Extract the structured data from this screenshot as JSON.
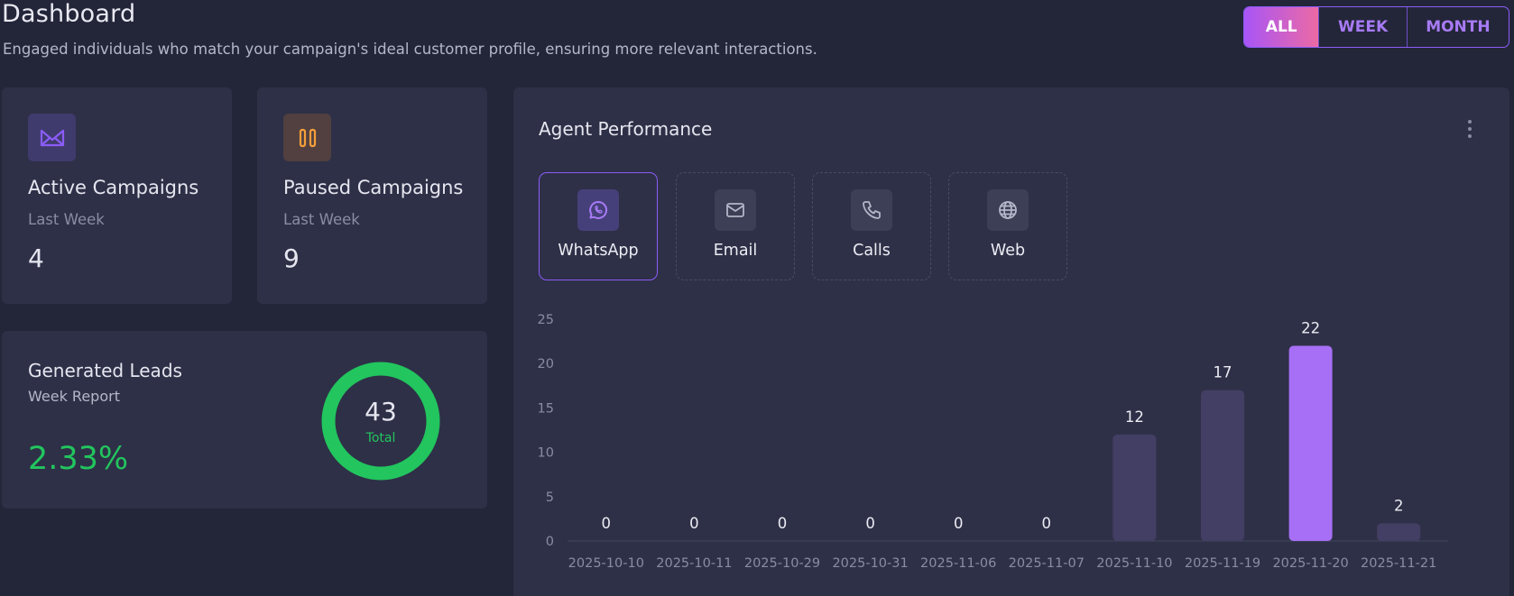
{
  "header": {
    "title": "Dashboard",
    "subtitle": "Engaged individuals who match your campaign's ideal customer profile, ensuring more relevant interactions."
  },
  "range_toggle": {
    "options": [
      "ALL",
      "WEEK",
      "MONTH"
    ],
    "selected": "ALL"
  },
  "cards": {
    "active": {
      "title": "Active Campaigns",
      "subtitle": "Last Week",
      "value": "4",
      "icon": "envelope-open-icon",
      "icon_color": "#8b5cf6"
    },
    "paused": {
      "title": "Paused Campaigns",
      "subtitle": "Last Week",
      "value": "9",
      "icon": "pause-icon",
      "icon_color": "#f59e3b"
    }
  },
  "leads": {
    "title": "Generated Leads",
    "subtitle": "Week Report",
    "percent": "2.33%",
    "total": "43",
    "total_label": "Total",
    "ring_color": "#22c55e"
  },
  "performance": {
    "title": "Agent Performance",
    "menu_icon": "more-vertical-icon",
    "channels": [
      {
        "label": "WhatsApp",
        "icon": "whatsapp-icon",
        "active": true
      },
      {
        "label": "Email",
        "icon": "mail-icon",
        "active": false
      },
      {
        "label": "Calls",
        "icon": "phone-icon",
        "active": false
      },
      {
        "label": "Web",
        "icon": "globe-icon",
        "active": false
      }
    ]
  },
  "chart_data": {
    "type": "bar",
    "categories": [
      "2025-10-10",
      "2025-10-11",
      "2025-10-29",
      "2025-10-31",
      "2025-11-06",
      "2025-11-07",
      "2025-11-10",
      "2025-11-19",
      "2025-11-20",
      "2025-11-21"
    ],
    "values": [
      0,
      0,
      0,
      0,
      0,
      0,
      12,
      17,
      22,
      2
    ],
    "yticks": [
      0,
      5,
      10,
      15,
      20,
      25
    ],
    "ylim": [
      0,
      25
    ],
    "highlight_index": 8,
    "bar_color": "#433e63",
    "highlight_color": "#a66ff5",
    "data_labels": true,
    "grid": false
  },
  "colors": {
    "background": "#232639",
    "card": "#2e3047",
    "accent": "#8b5cf6",
    "success": "#22c55e"
  }
}
